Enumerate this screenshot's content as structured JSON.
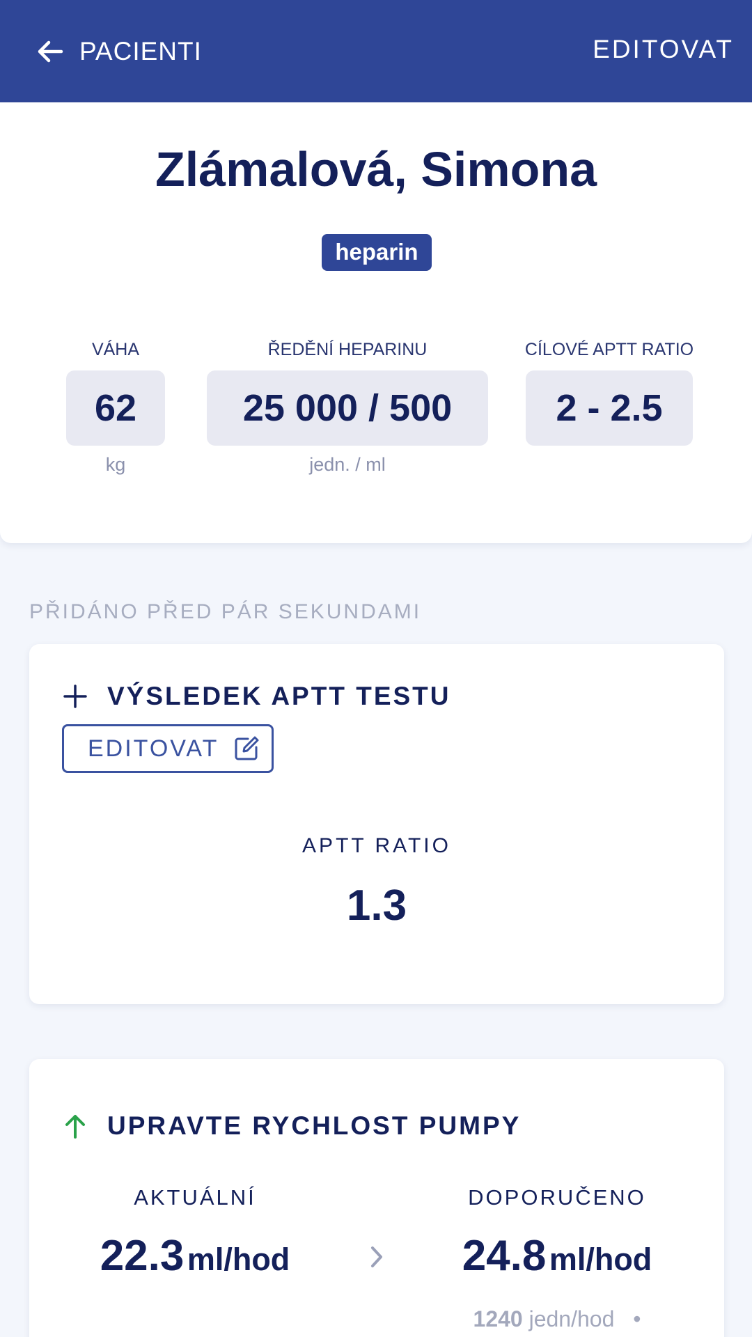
{
  "header": {
    "back_label": "PACIENTI",
    "edit_label": "EDITOVAT",
    "background": "#2f4697"
  },
  "patient": {
    "name": "Zlámalová, Simona",
    "drug": "heparin",
    "params": [
      {
        "label": "VÁHA",
        "value": "62",
        "unit": "kg"
      },
      {
        "label": "ŘEDĚNÍ HEPARINU",
        "value": "25 000 / 500",
        "unit": "jedn. / ml"
      },
      {
        "label": "CÍLOVÉ APTT RATIO",
        "value": "2 - 2.5",
        "unit": ""
      }
    ]
  },
  "feed": {
    "caption": "PŘIDÁNO PŘED PÁR SEKUNDAMI",
    "test_card": {
      "icon": "plus-icon",
      "title": "VÝSLEDEK APTT TESTU",
      "edit_label": "EDITOVAT",
      "edit_icon": "edit-icon",
      "metric_label": "APTT RATIO",
      "metric_value": "1.3"
    },
    "pump_card": {
      "icon": "arrow-up-icon",
      "title": "UPRAVTE RYCHLOST PUMPY",
      "current_label": "AKTUÁLNÍ",
      "current_value": "22.3",
      "current_unit": "ml/hod",
      "recommended_label": "DOPORUČENO",
      "recommended_value": "24.8",
      "recommended_unit": "ml/hod",
      "recommended_sub_value": "1240",
      "recommended_sub_unit": "jedn/hod",
      "recommended_sub_sep": "•"
    }
  },
  "colors": {
    "primary": "#2f4697",
    "text": "#14205a",
    "muted": "#a7adc0",
    "success": "#2aa24a",
    "value_box": "#e8e9f2"
  }
}
